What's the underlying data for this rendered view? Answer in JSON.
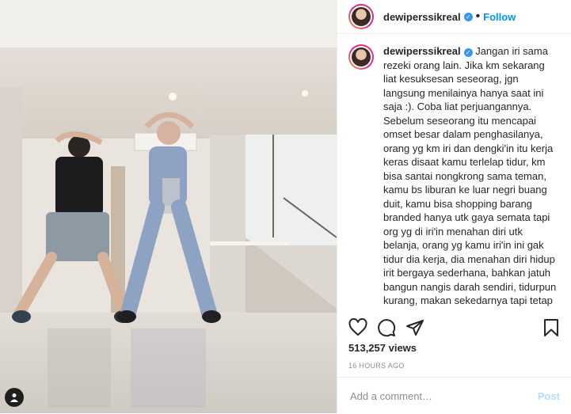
{
  "post": {
    "username": "dewiperssikreal",
    "verified": true,
    "follow_label": "Follow",
    "dot": "•",
    "caption_username": "dewiperssikreal",
    "caption_text": "Jangan iri sama rezeki orang lain. Jika km sekarang liat kesuksesan seseorag, jgn langsung menilainya hanya saat ini saja :). Coba liat perjuangannya. Sebelum seseorang itu mencapai omset besar dalam penghasilanya, orang yg km iri dan dengki'in itu kerja keras disaat kamu terlelap tidur, km bisa santai nongkrong sama teman, kamu bs liburan ke luar negri buang duit, kamu bisa shopping barang branded hanya utk gaya semata tapi org yg di iri'in menahan diri utk belanja, orang yg kamu iri'in ini gak tidur dia kerja, dia menahan diri hidup irit bergaya sederhana, bahkan jatuh bangun nangis darah sendiri, tidurpun kurang, makan sekedarnya tapi tetap",
    "views": "513,257 views",
    "time": "16 HOURS AGO",
    "comment_placeholder": "Add a comment…",
    "post_label": "Post"
  },
  "icons": {
    "like": "heart-icon",
    "comment": "comment-icon",
    "share": "paper-plane-icon",
    "save": "bookmark-icon",
    "tag": "user-tag-icon"
  },
  "colors": {
    "accent": "#0095f6",
    "verified": "#3897f0",
    "post_disabled": "#b2dffc",
    "muted": "#8e8e8e"
  }
}
